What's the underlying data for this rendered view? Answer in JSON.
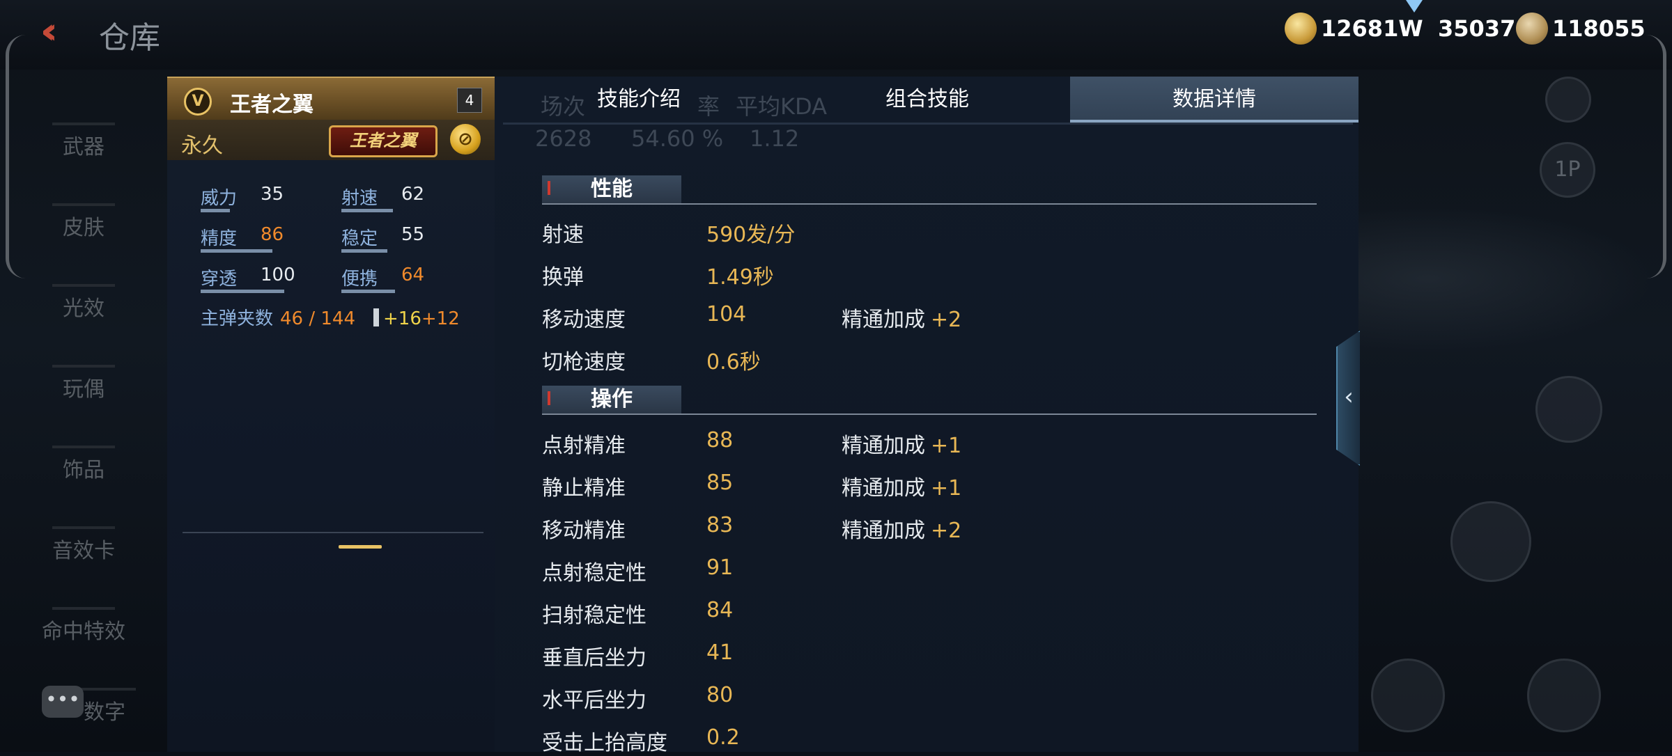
{
  "header": {
    "back_icon": "back-arrow-icon",
    "title": "仓库",
    "currencies": [
      {
        "icon": "gold-coin-icon",
        "value": "12681W"
      },
      {
        "icon": "diamond-icon",
        "value": "35037"
      },
      {
        "icon": "medal-coin-icon",
        "value": "118055"
      }
    ]
  },
  "categories": [
    "武器",
    "皮肤",
    "光效",
    "玩偶",
    "饰品",
    "音效卡",
    "命中特效",
    "数字"
  ],
  "weapon": {
    "name": "王者之翼",
    "count": "4",
    "vip_glyph": "V",
    "duration": "永久",
    "badge": "王者之翼",
    "stats": [
      {
        "label": "威力",
        "value": "35",
        "level": 0.35,
        "highlight": false
      },
      {
        "label": "射速",
        "value": "62",
        "level": 0.62,
        "highlight": false
      },
      {
        "label": "精度",
        "value": "86",
        "level": 0.86,
        "highlight": true
      },
      {
        "label": "稳定",
        "value": "55",
        "level": 0.55,
        "highlight": false
      },
      {
        "label": "穿透",
        "value": "100",
        "level": 1.0,
        "highlight": false
      },
      {
        "label": "便携",
        "value": "64",
        "level": 0.64,
        "highlight": true
      }
    ],
    "ammo_label": "主弹夹数",
    "ammo_value": "46 / 144",
    "ammo_bonus1": "+16",
    "ammo_bonus2": "+12"
  },
  "tabs": [
    {
      "label": "技能介绍",
      "active": false
    },
    {
      "label": "组合技能",
      "active": false
    },
    {
      "label": "数据详情",
      "active": true
    }
  ],
  "ghost_stats": [
    "场次",
    "率",
    "平均KDA",
    "2628",
    "54.60 %",
    "1.12"
  ],
  "sections": [
    {
      "title": "性能",
      "rows": [
        {
          "label": "射速",
          "value": "590发/分",
          "bonus_label": "",
          "bonus": ""
        },
        {
          "label": "换弹",
          "value": "1.49秒",
          "bonus_label": "",
          "bonus": ""
        },
        {
          "label": "移动速度",
          "value": "104",
          "bonus_label": "精通加成",
          "bonus": "+2"
        },
        {
          "label": "切枪速度",
          "value": "0.6秒",
          "bonus_label": "",
          "bonus": ""
        }
      ]
    },
    {
      "title": "操作",
      "rows": [
        {
          "label": "点射精准",
          "value": "88",
          "bonus_label": "精通加成",
          "bonus": "+1"
        },
        {
          "label": "静止精准",
          "value": "85",
          "bonus_label": "精通加成",
          "bonus": "+1"
        },
        {
          "label": "移动精准",
          "value": "83",
          "bonus_label": "精通加成",
          "bonus": "+2"
        },
        {
          "label": "点射稳定性",
          "value": "91",
          "bonus_label": "",
          "bonus": ""
        },
        {
          "label": "扫射稳定性",
          "value": "84",
          "bonus_label": "",
          "bonus": ""
        },
        {
          "label": "垂直后坐力",
          "value": "41",
          "bonus_label": "",
          "bonus": ""
        },
        {
          "label": "水平后坐力",
          "value": "80",
          "bonus_label": "",
          "bonus": ""
        },
        {
          "label": "受击上抬高度",
          "value": "0.2",
          "bonus_label": "",
          "bonus": ""
        }
      ]
    }
  ],
  "right_controls": [
    "1P"
  ],
  "colors": {
    "accent_gold": "#e8b755",
    "highlight_orange": "#f08a2c",
    "tab_active": "#3f5166"
  }
}
